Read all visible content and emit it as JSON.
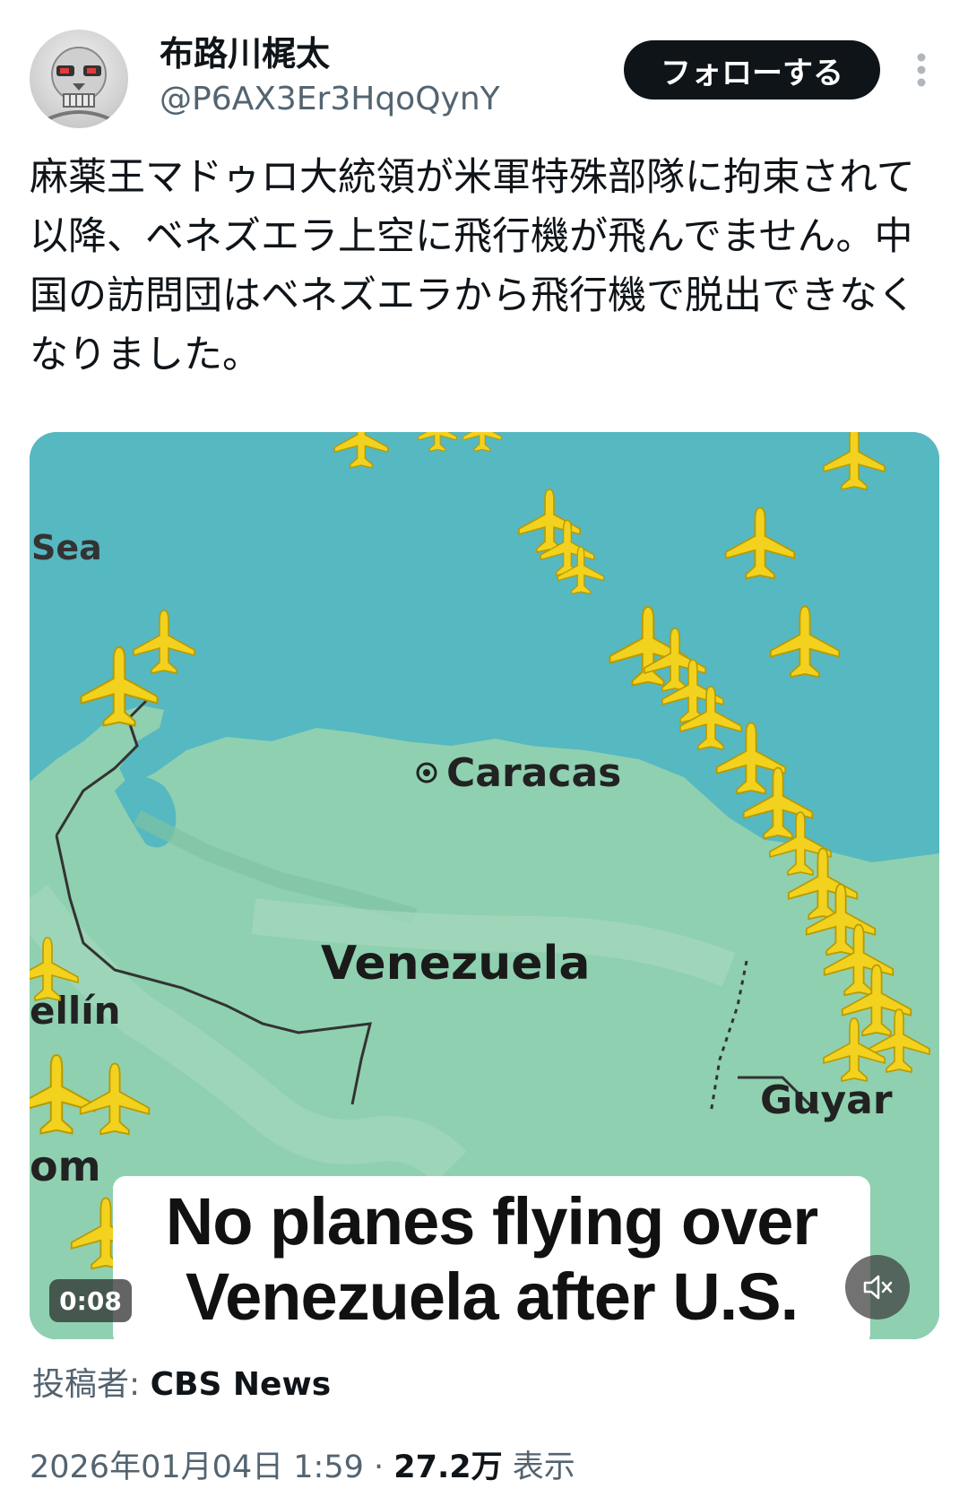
{
  "author": {
    "name": "布路川梶太",
    "handle": "@P6AX3Er3HqoQynY",
    "avatar_icon": "skull-avatar-icon"
  },
  "follow_button_label": "フォローする",
  "more_icon": "more-vertical-icon",
  "tweet": {
    "text": "麻薬王マドゥロ大統領が米軍特殊部隊に拘束されて以降、ベネズエラ上空に飛行機が飛んでません。中国の訪問団はベネズエラから飛行機で脱出できなくなりました。"
  },
  "video": {
    "map_labels": {
      "sea": "Sea",
      "caracas": "Caracas",
      "venezuela": "Venezuela",
      "medellin": "ellín",
      "colombia": "om",
      "guyana": "Guyar"
    },
    "caption_line1": "No planes flying over",
    "caption_line2": "Venezuela after U.S.",
    "duration": "0:08",
    "mute_icon": "speaker-muted-icon",
    "plane_icon": "airplane-icon",
    "colors": {
      "sea": "#56b8c0",
      "land": "#8fd0b0",
      "plane": "#f2d21e"
    }
  },
  "attribution": {
    "label": "投稿者: ",
    "source": "CBS News"
  },
  "meta": {
    "date": "2026年01月04日 1:59",
    "separator": " · ",
    "views_count": "27.2万",
    "views_label": " 表示"
  }
}
